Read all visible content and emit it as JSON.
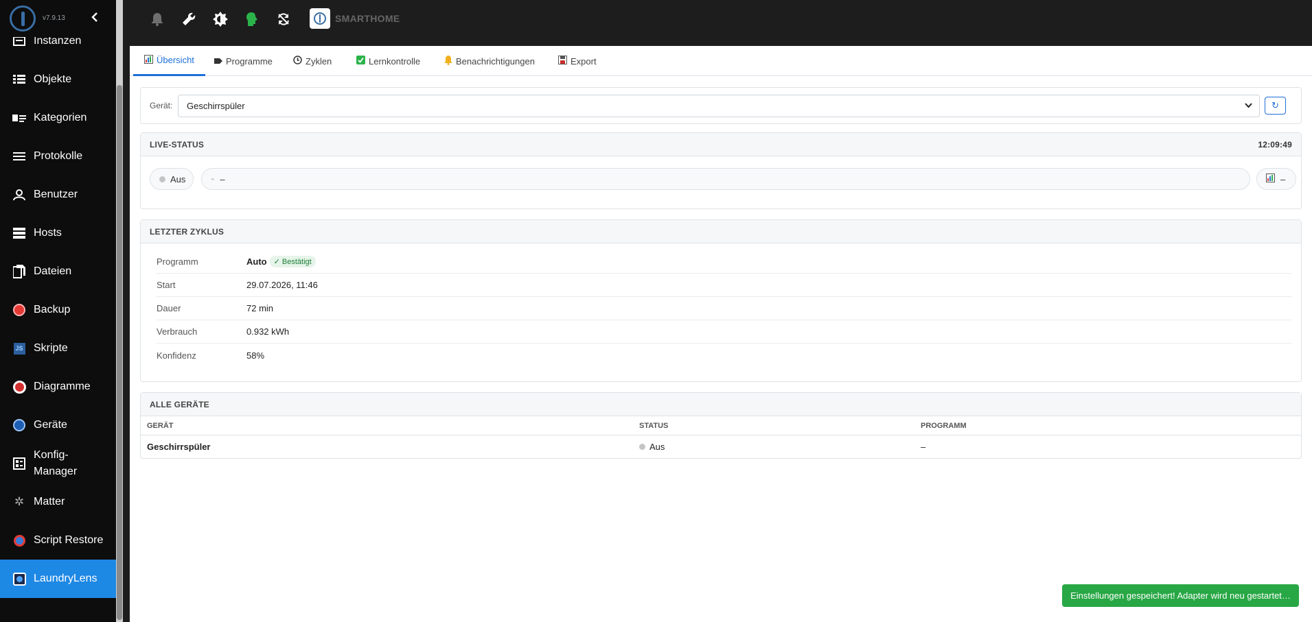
{
  "sidebar": {
    "version": "v7.9.13",
    "items": [
      {
        "label": "Instanzen",
        "icon": "instances-icon"
      },
      {
        "label": "Objekte",
        "icon": "list-icon"
      },
      {
        "label": "Kategorien",
        "icon": "categories-icon"
      },
      {
        "label": "Protokolle",
        "icon": "logs-icon"
      },
      {
        "label": "Benutzer",
        "icon": "user-icon"
      },
      {
        "label": "Hosts",
        "icon": "hosts-icon"
      },
      {
        "label": "Dateien",
        "icon": "files-icon"
      },
      {
        "label": "Backup",
        "icon": "backup-icon"
      },
      {
        "label": "Skripte",
        "icon": "scripts-icon"
      },
      {
        "label": "Diagramme",
        "icon": "charts-icon"
      },
      {
        "label": "Geräte",
        "icon": "devices-icon"
      },
      {
        "label": "Konfig-Manager",
        "icon": "config-manager-icon"
      },
      {
        "label": "Matter",
        "icon": "matter-icon"
      },
      {
        "label": "Script Restore",
        "icon": "script-restore-icon"
      },
      {
        "label": "LaundryLens",
        "icon": "laundrylens-icon"
      }
    ],
    "active": "LaundryLens"
  },
  "topbar": {
    "icons": [
      "bell-icon",
      "wrench-icon",
      "brightness-icon",
      "head-icon",
      "sync-icon"
    ],
    "brand": "SMARTHOME"
  },
  "tabs": [
    {
      "label": "Übersicht",
      "icon": "chart-icon"
    },
    {
      "label": "Programme",
      "icon": "tag-icon"
    },
    {
      "label": "Zyklen",
      "icon": "clock-icon"
    },
    {
      "label": "Lernkontrolle",
      "icon": "checkbox-icon"
    },
    {
      "label": "Benachrichtigungen",
      "icon": "bell-icon"
    },
    {
      "label": "Export",
      "icon": "save-icon"
    }
  ],
  "device": {
    "label": "Gerät:",
    "selected": "Geschirrspüler"
  },
  "live": {
    "title": "LIVE-STATUS",
    "time": "12:09:49",
    "status": "Aus",
    "power": "–",
    "chart": "–"
  },
  "cycle": {
    "title": "LETZTER ZYKLUS",
    "rows": [
      {
        "key": "Programm",
        "value": "Auto",
        "badge": "✓ Bestätigt"
      },
      {
        "key": "Start",
        "value": "29.07.2026, 11:46"
      },
      {
        "key": "Dauer",
        "value": "72 min"
      },
      {
        "key": "Verbrauch",
        "value": "0.932 kWh"
      },
      {
        "key": "Konfidenz",
        "value": "58%"
      }
    ]
  },
  "all_devices": {
    "title": "ALLE GERÄTE",
    "columns": [
      "GERÄT",
      "STATUS",
      "PROGRAMM"
    ],
    "rows": [
      {
        "device": "Geschirrspüler",
        "status": "Aus",
        "program": "–"
      }
    ]
  },
  "toast": "Einstellungen gespeichert! Adapter wird neu gestartet…",
  "colors": {
    "accent": "#1e88e5",
    "success": "#28a745",
    "sidebar_bg": "#0d0d0d"
  }
}
